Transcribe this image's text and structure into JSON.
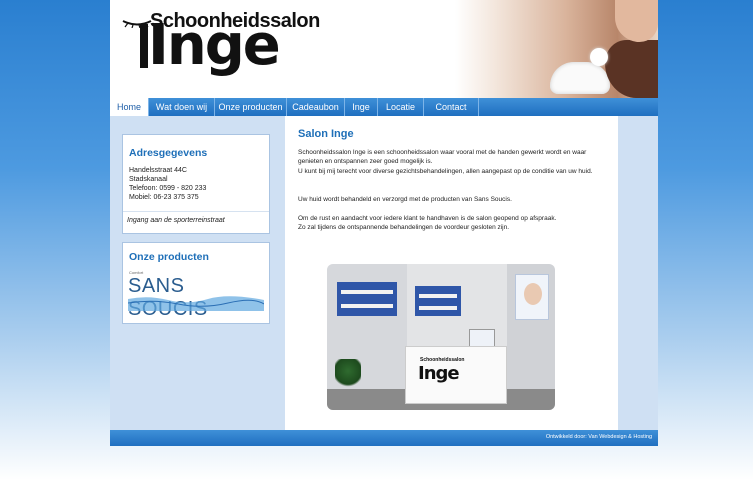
{
  "header": {
    "logo_top": "Schoonheidssalon",
    "logo_main": "Inge"
  },
  "nav": {
    "items": [
      "Home",
      "Wat doen wij",
      "Onze producten",
      "Cadeaubon",
      "Inge",
      "Locatie",
      "Contact"
    ],
    "active_index": 0
  },
  "sidebar": {
    "address_box": {
      "title": "Adresgegevens",
      "lines": [
        "Handelsstraat 44C",
        "Stadskanaal",
        "Telefoon:   0599 - 820 233",
        "Mobiel:      06-23 375 375"
      ],
      "note": "Ingang aan de sporterreinstraat"
    },
    "products_box": {
      "title": "Onze producten",
      "brand_prefix": "Comfort",
      "brand": "SANS SOUCIS"
    }
  },
  "main": {
    "title": "Salon Inge",
    "paragraphs": [
      "Schoonheidssalon Inge is een schoonheidssalon waar vooral met de handen gewerkt wordt en waar genieten en ontspannen zeer goed mogelijk is.",
      "U kunt bij mij terecht voor diverse gezichtsbehandelingen, allen aangepast op de conditie van uw huid.",
      "Uw huid wordt behandeld en verzorgd met de producten van Sans Soucis.",
      "Om de rust en aandacht voor iedere klant te handhaven is de salon geopend op afspraak.",
      "Zo zal tijdens de ontspannende behandelingen de voordeur gesloten zijn."
    ],
    "photo_sign_top": "Schoonheidssalon",
    "photo_sign_main": "Inge"
  },
  "footer": {
    "credit": "Ontwikkeld door: Van Webdesign & Hosting"
  },
  "colors": {
    "accent": "#1e6fb8",
    "nav_bar": "#2f80cc",
    "sidebar_bg": "#cfe0f3"
  }
}
